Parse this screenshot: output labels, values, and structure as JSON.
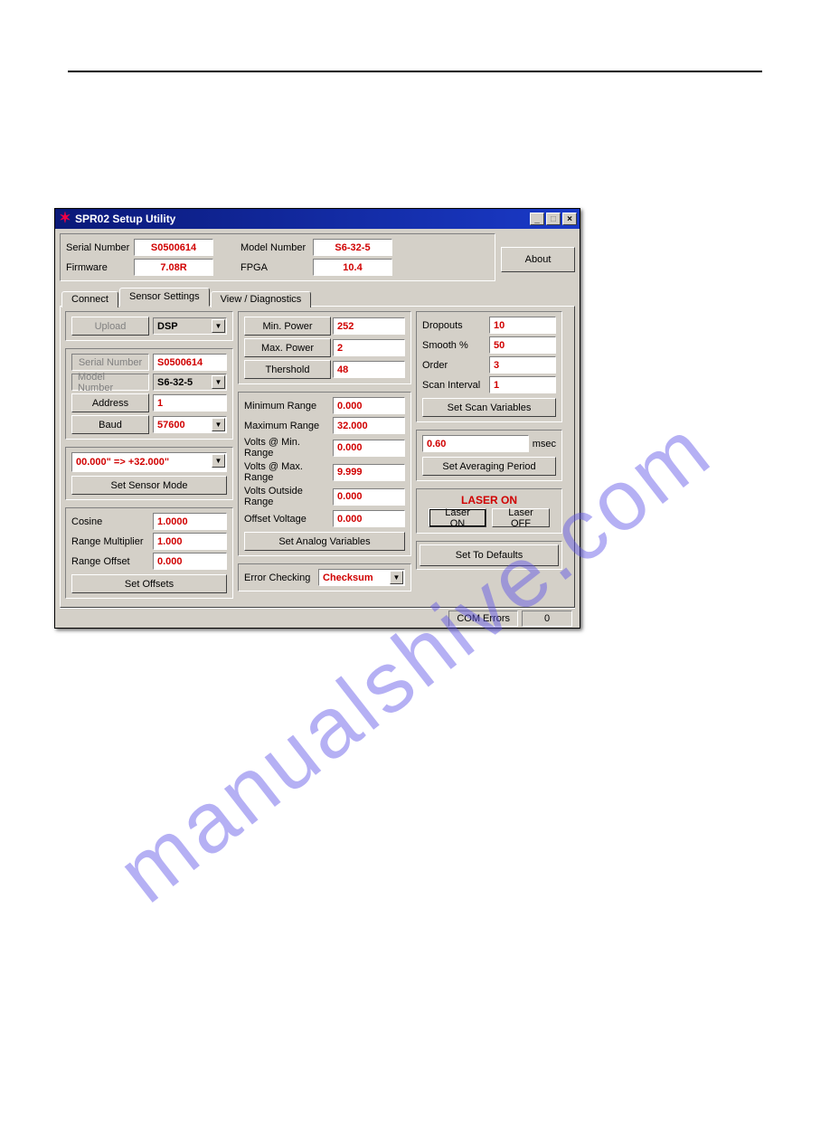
{
  "watermark": "manualshive.com",
  "window": {
    "title": "SPR02 Setup Utility"
  },
  "header": {
    "serial_label": "Serial Number",
    "serial_value": "S0500614",
    "firmware_label": "Firmware",
    "firmware_value": "7.08R",
    "model_label": "Model Number",
    "model_value": "S6-32-5",
    "fpga_label": "FPGA",
    "fpga_value": "10.4",
    "about_label": "About"
  },
  "tabs": {
    "connect": "Connect",
    "sensor": "Sensor Settings",
    "view": "View / Diagnostics"
  },
  "left": {
    "upload_label": "Upload",
    "upload_value": "DSP",
    "serial_label": "Serial Number",
    "serial_value": "S0500614",
    "model_label": "Model Number",
    "model_value": "S6-32-5",
    "address_label": "Address",
    "address_value": "1",
    "baud_label": "Baud",
    "baud_value": "57600",
    "mode_value": "00.000\"  => +32.000\"",
    "set_mode_label": "Set Sensor Mode",
    "cosine_label": "Cosine",
    "cosine_value": "1.0000",
    "rmult_label": "Range Multiplier",
    "rmult_value": "1.000",
    "roff_label": "Range Offset",
    "roff_value": "0.000",
    "set_offsets_label": "Set Offsets"
  },
  "mid": {
    "minpow_label": "Min. Power",
    "minpow_value": "252",
    "maxpow_label": "Max. Power",
    "maxpow_value": "2",
    "thresh_label": "Thershold",
    "thresh_value": "48",
    "minrange_label": "Minimum Range",
    "minrange_value": "0.000",
    "maxrange_label": "Maximum Range",
    "maxrange_value": "32.000",
    "vmin_label": "Volts @ Min. Range",
    "vmin_value": "0.000",
    "vmax_label": "Volts @ Max. Range",
    "vmax_value": "9.999",
    "vout_label": "Volts Outside Range",
    "vout_value": "0.000",
    "offv_label": "Offset Voltage",
    "offv_value": "0.000",
    "set_analog_label": "Set Analog Variables",
    "err_label": "Error Checking",
    "err_value": "Checksum"
  },
  "right": {
    "drop_label": "Dropouts",
    "drop_value": "10",
    "smooth_label": "Smooth %",
    "smooth_value": "50",
    "order_label": "Order",
    "order_value": "3",
    "scan_label": "Scan Interval",
    "scan_value": "1",
    "set_scan_label": "Set Scan Variables",
    "avg_value": "0.60",
    "avg_unit": "msec",
    "set_avg_label": "Set  Averaging Period",
    "laser_hdr": "LASER ON",
    "laser_on_label": "Laser ON",
    "laser_off_label": "Laser OFF",
    "defaults_label": "Set To Defaults"
  },
  "status": {
    "com_label": "COM Errors",
    "com_value": "0"
  }
}
